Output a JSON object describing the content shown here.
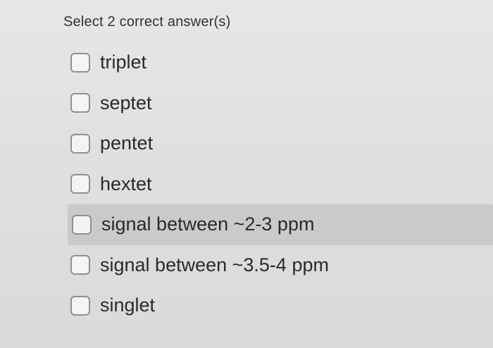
{
  "question": {
    "prompt": "Select 2 correct answer(s)"
  },
  "options": [
    {
      "label": "triplet",
      "checked": false
    },
    {
      "label": "septet",
      "checked": false
    },
    {
      "label": "pentet",
      "checked": false
    },
    {
      "label": "hextet",
      "checked": false
    },
    {
      "label": "signal between ~2-3 ppm",
      "checked": false,
      "hovered": true
    },
    {
      "label": "signal between ~3.5-4 ppm",
      "checked": false
    },
    {
      "label": "singlet",
      "checked": false
    }
  ]
}
